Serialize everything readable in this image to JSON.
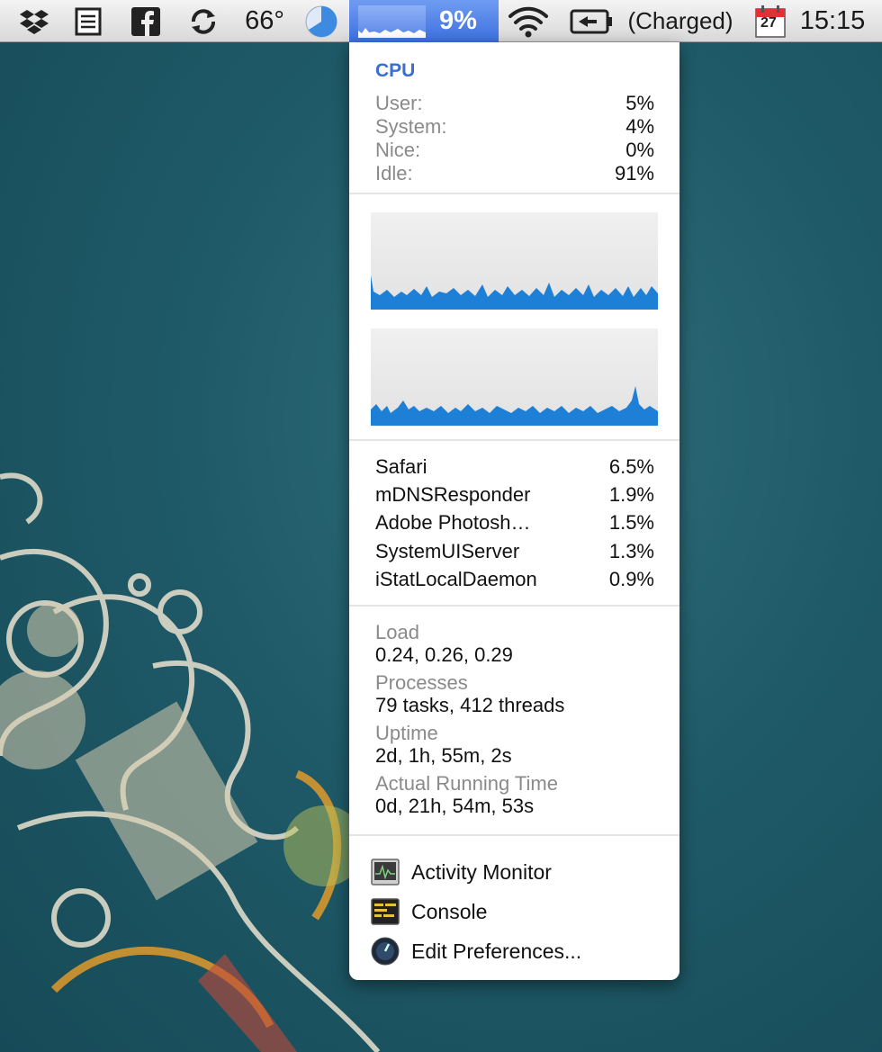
{
  "menubar": {
    "temperature": "66°",
    "cpu_percent": "9%",
    "battery_status": "(Charged)",
    "calendar_day": "27",
    "clock": "15:15",
    "icons": [
      "dropbox-icon",
      "notes-icon",
      "facebook-icon",
      "sync-icon",
      "temperature-label",
      "pie-clock-icon",
      "cpu-menu-graph",
      "wifi-icon",
      "battery-icon",
      "calendar-icon"
    ]
  },
  "cpu": {
    "title": "CPU",
    "stats": [
      {
        "label": "User:",
        "value": "5%"
      },
      {
        "label": "System:",
        "value": "4%"
      },
      {
        "label": "Nice:",
        "value": "0%"
      },
      {
        "label": "Idle:",
        "value": "91%"
      }
    ]
  },
  "processes_top": [
    {
      "name": "Safari",
      "value": "6.5%"
    },
    {
      "name": "mDNSResponder",
      "value": "1.9%"
    },
    {
      "name": "Adobe Photosh…",
      "value": "1.5%"
    },
    {
      "name": "SystemUIServer",
      "value": "1.3%"
    },
    {
      "name": "iStatLocalDaemon",
      "value": "0.9%"
    }
  ],
  "info": {
    "load_label": "Load",
    "load_value": "0.24, 0.26, 0.29",
    "processes_label": "Processes",
    "processes_value": "79 tasks, 412 threads",
    "uptime_label": "Uptime",
    "uptime_value": "2d, 1h, 55m, 2s",
    "running_label": "Actual Running Time",
    "running_value": "0d, 21h, 54m, 53s"
  },
  "links": {
    "activity_monitor": "Activity Monitor",
    "console": "Console",
    "edit_preferences": "Edit Preferences..."
  },
  "colors": {
    "accent": "#3a6fd1",
    "graph_fill": "#1e7fd6",
    "menubar_highlight": "#4f7fe8"
  }
}
